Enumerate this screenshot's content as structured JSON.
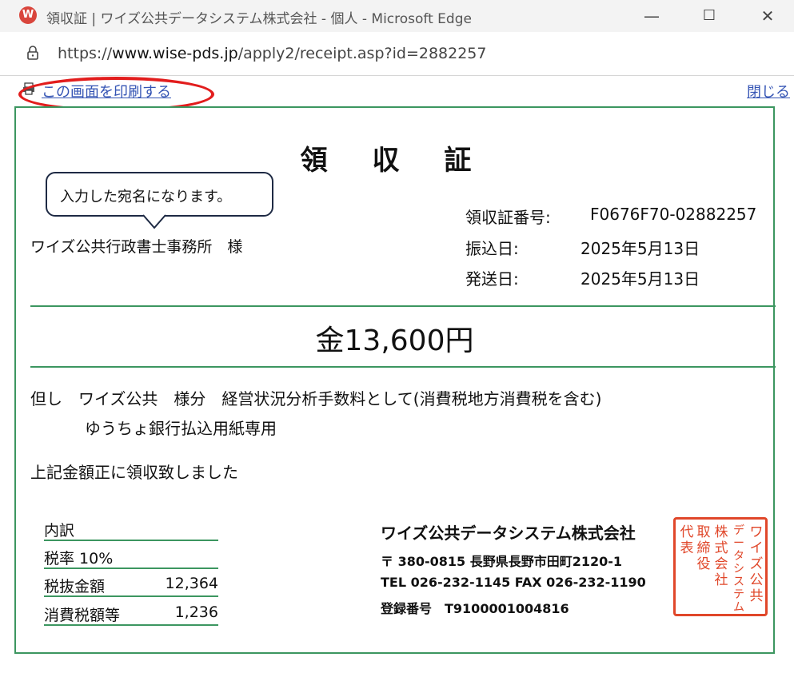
{
  "window": {
    "app_icon": "edge-w-logo",
    "title": "領収証 | ワイズ公共データシステム株式会社 - 個人 - Microsoft Edge",
    "minimize": "—",
    "maximize": "☐",
    "close": "✕"
  },
  "addressbar": {
    "url_prefix": "https://",
    "url_domain": "www.wise-pds.jp",
    "url_path": "/apply2/receipt.asp?id=2882257"
  },
  "toolbar": {
    "print_link": "この画面を印刷する",
    "close_link": "閉じる"
  },
  "receipt": {
    "title": "領 収 証",
    "callout": "入力した宛名になります。",
    "recipient": "ワイズ公共行政書士事務所　様",
    "receipt_no_label": "領収証番号:",
    "receipt_no": "F0676F70-02882257",
    "transfer_date_label": "振込日:",
    "transfer_date": "2025年5月13日",
    "ship_date_label": "発送日:",
    "ship_date": "2025年5月13日",
    "amount": "金13,600円",
    "purpose_line1": "但し　ワイズ公共　様分　経営状況分析手数料として(消費税地方消費税を含む)",
    "purpose_line2": "ゆうちょ銀行払込用紙専用",
    "acknowledgement": "上記金額正に領収致しました",
    "breakdown": {
      "heading": "内訳",
      "tax_rate": "税率  10%",
      "net_label": "税抜金額",
      "net_value": "12,364",
      "tax_label": "消費税額等",
      "tax_value": "1,236"
    },
    "issuer": {
      "company": "ワイズ公共データシステム株式会社",
      "address": "〒 380-0815 長野県長野市田町2120-1",
      "contact": "TEL 026-232-1145  FAX 026-232-1190",
      "registration": "登録番号　T9100001004816"
    },
    "seal": {
      "columns": [
        "ワイズ公共",
        "データシステム",
        "株式会社",
        "取締役",
        "代表"
      ],
      "color": "#e0472a"
    }
  },
  "colors": {
    "frame_green": "#3c9660",
    "link_blue": "#3454b4",
    "highlight_red": "#e21d1d"
  }
}
